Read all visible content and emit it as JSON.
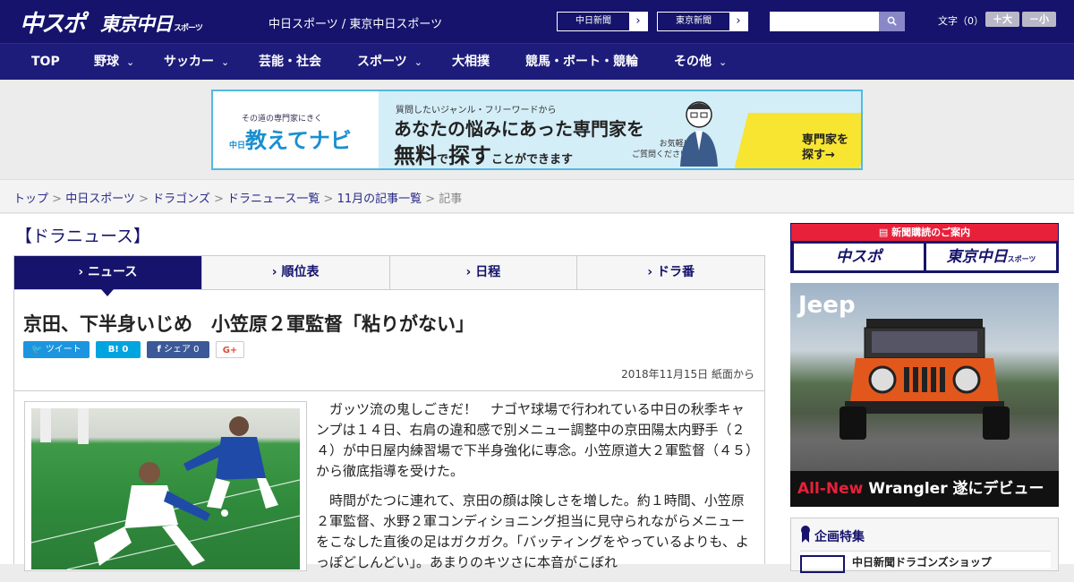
{
  "header": {
    "logo_main": "中スポ",
    "logo_tokyo": "東京中日",
    "logo_tokyo_sub": "スポーツ",
    "site_title": "中日スポーツ / 東京中日スポーツ",
    "site_links": [
      "中日新聞",
      "東京新聞"
    ],
    "search_placeholder": "",
    "font_label": "文字（0）",
    "font_up": "＋大",
    "font_down": "－小"
  },
  "nav": [
    {
      "label": "TOP",
      "dropdown": false
    },
    {
      "label": "野球",
      "dropdown": true
    },
    {
      "label": "サッカー",
      "dropdown": true
    },
    {
      "label": "芸能・社会",
      "dropdown": false
    },
    {
      "label": "スポーツ",
      "dropdown": true
    },
    {
      "label": "大相撲",
      "dropdown": false
    },
    {
      "label": "競馬・ボート・競輪",
      "dropdown": false
    },
    {
      "label": "その他",
      "dropdown": true
    }
  ],
  "banner": {
    "tagline": "その道の専門家にきく",
    "brand_prefix": "中日",
    "brand": "教えてナビ",
    "line1": "質問したいジャンル・フリーワードから",
    "line2": "あなたの悩みにあった専門家を",
    "line3a": "無料",
    "line3b": "で",
    "line3c": "探す",
    "line3d": "ことができます",
    "note": "お気軽に\nご質問ください!",
    "cta": "専門家を\n探す→"
  },
  "breadcrumb": {
    "links": [
      "トップ",
      "中日スポーツ",
      "ドラゴンズ",
      "ドラニュース一覧",
      "11月の記事一覧"
    ],
    "current": "記事",
    "separator": " > "
  },
  "section_title": "【ドラニュース】",
  "tabs": [
    {
      "label": "ニュース",
      "active": true
    },
    {
      "label": "順位表",
      "active": false
    },
    {
      "label": "日程",
      "active": false
    },
    {
      "label": "ドラ番",
      "active": false
    }
  ],
  "article": {
    "headline": "京田、下半身いじめ　小笠原２軍監督「粘りがない」",
    "share": {
      "tweet": "ツイート",
      "hatena": "B! 0",
      "facebook": "シェア 0",
      "gplus": "G+"
    },
    "date": "2018年11月15日 紙面から",
    "paragraphs": [
      "ガッツ流の鬼しごきだ！　ナゴヤ球場で行われている中日の秋季キャンプは１４日、右肩の違和感で別メニュー調整中の京田陽太内野手（２４）が中日屋内練習場で下半身強化に専念。小笠原道大２軍監督（４５）から徹底指導を受けた。",
      "時間がたつに連れて、京田の顔は険しさを増した。約１時間、小笠原２軍監督、水野２軍コンディショニング担当に見守られながらメニューをこなした直後の足はガクガク。「バッティングをやっているよりも、よっぽどしんどい」。あまりのキツさに本音がこぼれ"
    ]
  },
  "sidebar": {
    "subscribe_header": "新聞購読のご案内",
    "subscribe_logos": [
      "中スポ",
      "東京中日"
    ],
    "subscribe_logo_sub": "スポーツ",
    "ad_brand": "Jeep",
    "ad_tag_new": "All-New",
    "ad_tag_model": " Wrangler 遂にデビュー",
    "feature_title": "企画特集",
    "feature_item": "中日新聞ドラゴンズショップ"
  },
  "colors": {
    "navy": "#15136b",
    "nav": "#1e1c7a",
    "accent_red": "#e8203a",
    "banner_blue": "#53b9e0"
  }
}
